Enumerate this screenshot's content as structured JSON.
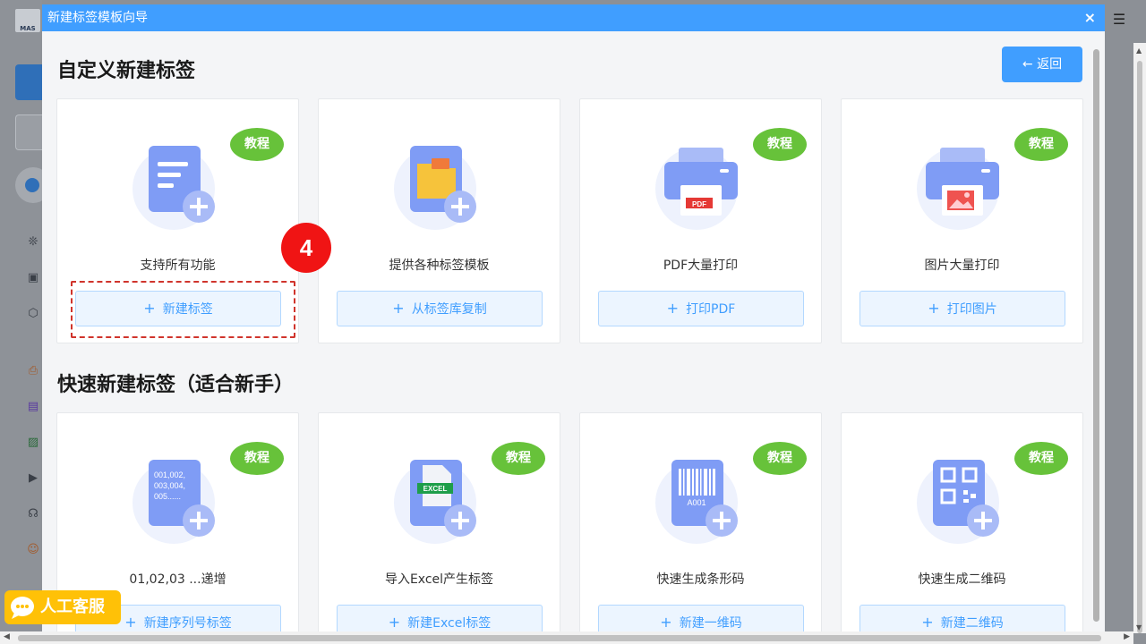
{
  "dialog": {
    "title": "新建标签模板向导",
    "close_label": "×",
    "back_label": "返回",
    "back_arrow": "←"
  },
  "step_badge": "4",
  "background": {
    "logo_text": "MAS"
  },
  "section1": {
    "title": "自定义新建标签",
    "cards": [
      {
        "badge": "教程",
        "caption": "支持所有功能",
        "button": "新建标签",
        "icon": "document-plus-icon"
      },
      {
        "badge": "",
        "caption": "提供各种标签模板",
        "button": "从标签库复制",
        "icon": "folder-plus-icon"
      },
      {
        "badge": "教程",
        "caption": "PDF大量打印",
        "button": "打印PDF",
        "icon": "printer-pdf-icon"
      },
      {
        "badge": "教程",
        "caption": "图片大量打印",
        "button": "打印图片",
        "icon": "printer-image-icon"
      }
    ]
  },
  "section2": {
    "title": "快速新建标签（适合新手）",
    "cards": [
      {
        "badge": "教程",
        "caption": "01,02,03 ...递增",
        "button": "新建序列号标签",
        "icon": "serial-number-icon",
        "illus_text": [
          "001,002,",
          "003,004,",
          "005......"
        ]
      },
      {
        "badge": "教程",
        "caption": "导入Excel产生标签",
        "button": "新建Excel标签",
        "icon": "excel-icon",
        "illus_text": [
          "EXCEL"
        ]
      },
      {
        "badge": "教程",
        "caption": "快速生成条形码",
        "button": "新建一维码",
        "icon": "barcode-icon",
        "illus_text": [
          "A001"
        ]
      },
      {
        "badge": "教程",
        "caption": "快速生成二维码",
        "button": "新建二维码",
        "icon": "qrcode-icon"
      }
    ]
  },
  "customer_service": {
    "label": "人工客服"
  },
  "pdf_tag": "PDF",
  "plus_sign": "+",
  "colors": {
    "primary": "#409eff",
    "badge_green": "#67c23a",
    "step_red": "#f01414",
    "service_yellow": "#ffc107"
  }
}
